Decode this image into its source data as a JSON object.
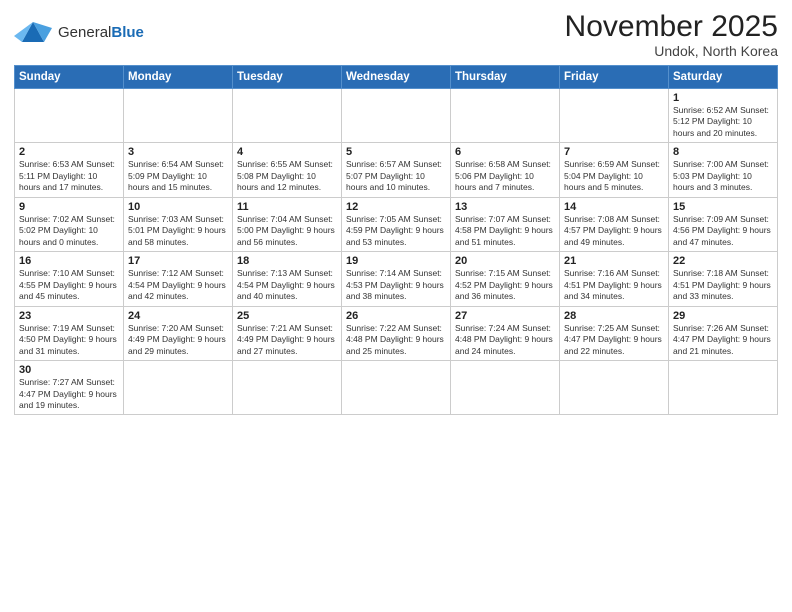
{
  "logo": {
    "general": "General",
    "blue": "Blue"
  },
  "header": {
    "month": "November 2025",
    "location": "Undok, North Korea"
  },
  "weekdays": [
    "Sunday",
    "Monday",
    "Tuesday",
    "Wednesday",
    "Thursday",
    "Friday",
    "Saturday"
  ],
  "weeks": [
    [
      {
        "day": "",
        "info": ""
      },
      {
        "day": "",
        "info": ""
      },
      {
        "day": "",
        "info": ""
      },
      {
        "day": "",
        "info": ""
      },
      {
        "day": "",
        "info": ""
      },
      {
        "day": "",
        "info": ""
      },
      {
        "day": "1",
        "info": "Sunrise: 6:52 AM\nSunset: 5:12 PM\nDaylight: 10 hours and 20 minutes."
      }
    ],
    [
      {
        "day": "2",
        "info": "Sunrise: 6:53 AM\nSunset: 5:11 PM\nDaylight: 10 hours and 17 minutes."
      },
      {
        "day": "3",
        "info": "Sunrise: 6:54 AM\nSunset: 5:09 PM\nDaylight: 10 hours and 15 minutes."
      },
      {
        "day": "4",
        "info": "Sunrise: 6:55 AM\nSunset: 5:08 PM\nDaylight: 10 hours and 12 minutes."
      },
      {
        "day": "5",
        "info": "Sunrise: 6:57 AM\nSunset: 5:07 PM\nDaylight: 10 hours and 10 minutes."
      },
      {
        "day": "6",
        "info": "Sunrise: 6:58 AM\nSunset: 5:06 PM\nDaylight: 10 hours and 7 minutes."
      },
      {
        "day": "7",
        "info": "Sunrise: 6:59 AM\nSunset: 5:04 PM\nDaylight: 10 hours and 5 minutes."
      },
      {
        "day": "8",
        "info": "Sunrise: 7:00 AM\nSunset: 5:03 PM\nDaylight: 10 hours and 3 minutes."
      }
    ],
    [
      {
        "day": "9",
        "info": "Sunrise: 7:02 AM\nSunset: 5:02 PM\nDaylight: 10 hours and 0 minutes."
      },
      {
        "day": "10",
        "info": "Sunrise: 7:03 AM\nSunset: 5:01 PM\nDaylight: 9 hours and 58 minutes."
      },
      {
        "day": "11",
        "info": "Sunrise: 7:04 AM\nSunset: 5:00 PM\nDaylight: 9 hours and 56 minutes."
      },
      {
        "day": "12",
        "info": "Sunrise: 7:05 AM\nSunset: 4:59 PM\nDaylight: 9 hours and 53 minutes."
      },
      {
        "day": "13",
        "info": "Sunrise: 7:07 AM\nSunset: 4:58 PM\nDaylight: 9 hours and 51 minutes."
      },
      {
        "day": "14",
        "info": "Sunrise: 7:08 AM\nSunset: 4:57 PM\nDaylight: 9 hours and 49 minutes."
      },
      {
        "day": "15",
        "info": "Sunrise: 7:09 AM\nSunset: 4:56 PM\nDaylight: 9 hours and 47 minutes."
      }
    ],
    [
      {
        "day": "16",
        "info": "Sunrise: 7:10 AM\nSunset: 4:55 PM\nDaylight: 9 hours and 45 minutes."
      },
      {
        "day": "17",
        "info": "Sunrise: 7:12 AM\nSunset: 4:54 PM\nDaylight: 9 hours and 42 minutes."
      },
      {
        "day": "18",
        "info": "Sunrise: 7:13 AM\nSunset: 4:54 PM\nDaylight: 9 hours and 40 minutes."
      },
      {
        "day": "19",
        "info": "Sunrise: 7:14 AM\nSunset: 4:53 PM\nDaylight: 9 hours and 38 minutes."
      },
      {
        "day": "20",
        "info": "Sunrise: 7:15 AM\nSunset: 4:52 PM\nDaylight: 9 hours and 36 minutes."
      },
      {
        "day": "21",
        "info": "Sunrise: 7:16 AM\nSunset: 4:51 PM\nDaylight: 9 hours and 34 minutes."
      },
      {
        "day": "22",
        "info": "Sunrise: 7:18 AM\nSunset: 4:51 PM\nDaylight: 9 hours and 33 minutes."
      }
    ],
    [
      {
        "day": "23",
        "info": "Sunrise: 7:19 AM\nSunset: 4:50 PM\nDaylight: 9 hours and 31 minutes."
      },
      {
        "day": "24",
        "info": "Sunrise: 7:20 AM\nSunset: 4:49 PM\nDaylight: 9 hours and 29 minutes."
      },
      {
        "day": "25",
        "info": "Sunrise: 7:21 AM\nSunset: 4:49 PM\nDaylight: 9 hours and 27 minutes."
      },
      {
        "day": "26",
        "info": "Sunrise: 7:22 AM\nSunset: 4:48 PM\nDaylight: 9 hours and 25 minutes."
      },
      {
        "day": "27",
        "info": "Sunrise: 7:24 AM\nSunset: 4:48 PM\nDaylight: 9 hours and 24 minutes."
      },
      {
        "day": "28",
        "info": "Sunrise: 7:25 AM\nSunset: 4:47 PM\nDaylight: 9 hours and 22 minutes."
      },
      {
        "day": "29",
        "info": "Sunrise: 7:26 AM\nSunset: 4:47 PM\nDaylight: 9 hours and 21 minutes."
      }
    ],
    [
      {
        "day": "30",
        "info": "Sunrise: 7:27 AM\nSunset: 4:47 PM\nDaylight: 9 hours and 19 minutes."
      },
      {
        "day": "",
        "info": ""
      },
      {
        "day": "",
        "info": ""
      },
      {
        "day": "",
        "info": ""
      },
      {
        "day": "",
        "info": ""
      },
      {
        "day": "",
        "info": ""
      },
      {
        "day": "",
        "info": ""
      }
    ]
  ]
}
